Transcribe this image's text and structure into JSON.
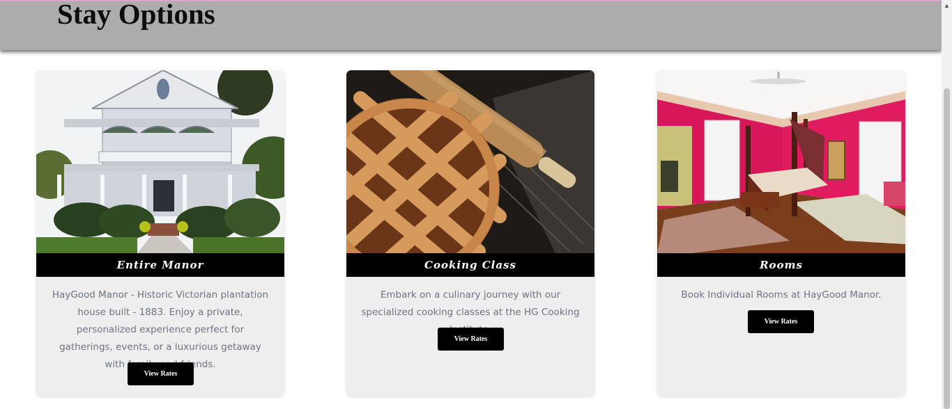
{
  "header": {
    "title": "Stay Options"
  },
  "cards": [
    {
      "label": "Entire Manor",
      "image": "victorian-manor-photo",
      "description": "HayGood Manor - Historic Victorian plantation house built - 1883. Enjoy a private, personalized experience perfect for gatherings, events, or a luxurious getaway with family and friends.",
      "button_label": "View Rates"
    },
    {
      "label": "Cooking Class",
      "image": "lattice-pie-photo",
      "description": "Embark on a culinary journey with our specialized cooking classes at the HG Cooking Institute.",
      "button_label": "View Rates"
    },
    {
      "label": "Rooms",
      "image": "canopy-bedroom-photo",
      "description": "Book Individual Rooms at HayGood Manor.",
      "button_label": "View Rates"
    }
  ],
  "scrollbar": {
    "up_icon": "scroll-up-arrow-icon"
  },
  "colors": {
    "header_band": "#acacac",
    "card_bg": "#eeeeee",
    "label_bar": "#000000",
    "button_bg": "#000000",
    "description_text": "#6e7382"
  }
}
